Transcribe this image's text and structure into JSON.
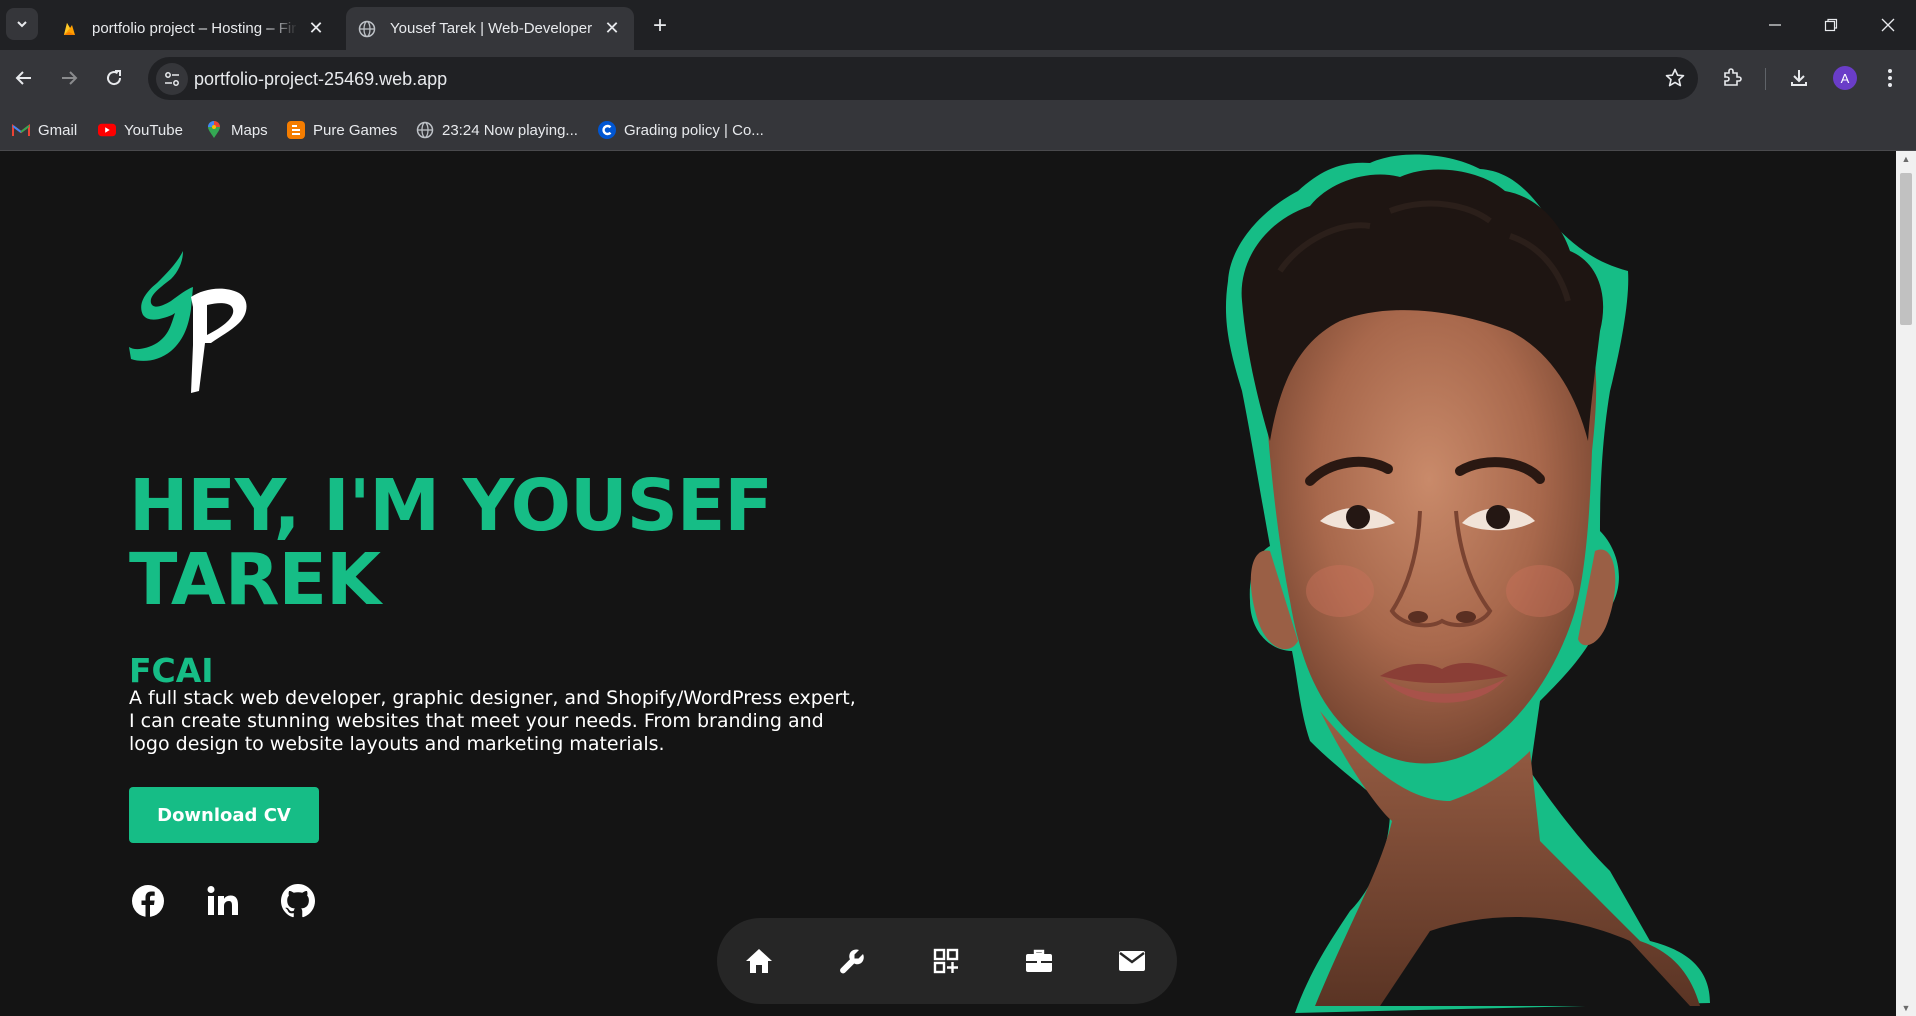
{
  "browser": {
    "tabs": [
      {
        "title": "portfolio project – Hosting – Fir",
        "favicon": "firebase-icon",
        "active": false
      },
      {
        "title": "Yousef Tarek | Web-Developer",
        "favicon": "globe-icon",
        "active": true
      }
    ],
    "url": "portfolio-project-25469.web.app",
    "profile_initial": "A",
    "bookmarks": [
      {
        "label": "Gmail",
        "icon": "gmail-icon"
      },
      {
        "label": "YouTube",
        "icon": "youtube-icon"
      },
      {
        "label": "Maps",
        "icon": "maps-icon"
      },
      {
        "label": "Pure Games",
        "icon": "blogger-icon"
      },
      {
        "label": "23:24 Now playing...",
        "icon": "globe-icon"
      },
      {
        "label": "Grading policy | Co...",
        "icon": "coursera-icon"
      }
    ]
  },
  "hero": {
    "title_line1": "HEY, I'M YOUSEF",
    "title_line2": "TAREK",
    "subtitle": "FCAI",
    "description": "A full stack web developer, graphic designer, and Shopify/WordPress expert, I can create stunning websites that meet your needs. From branding and logo design to website layouts and marketing materials.",
    "cv_button": "Download CV",
    "socials": [
      "facebook-icon",
      "linkedin-icon",
      "github-icon"
    ]
  },
  "dock": [
    "home-icon",
    "wrench-icon",
    "qr-grid-icon",
    "briefcase-icon",
    "mail-icon"
  ],
  "colors": {
    "accent": "#16bd86",
    "background": "#141414",
    "dock": "#262626",
    "text": "#ffffff"
  }
}
